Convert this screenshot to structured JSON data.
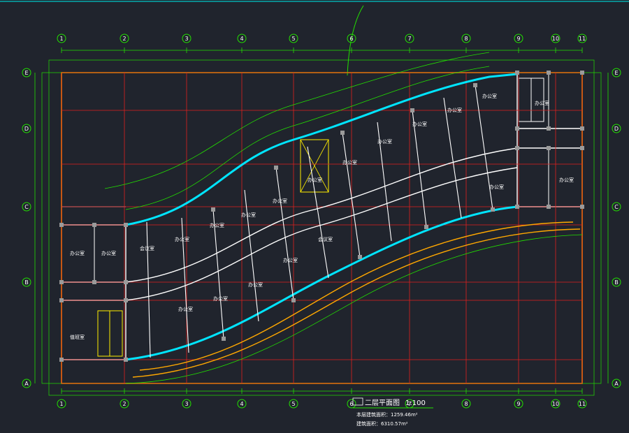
{
  "colors": {
    "background": "#20242d",
    "grid_axis": "#e0201e",
    "dimension": "#22e000",
    "wall": "#ffffff",
    "outline": "#ffa800",
    "glass": "#00e5ff",
    "furniture": "#e000e0",
    "text": "#ffffff",
    "stair_yellow": "#ffee00",
    "top_line": "#00c8c8"
  },
  "grid_top_labels": [
    "1",
    "2",
    "3",
    "4",
    "5",
    "6",
    "7",
    "8",
    "9",
    "10",
    "11"
  ],
  "grid_bottom_labels": [
    "1",
    "2",
    "3",
    "4",
    "5",
    "6",
    "7",
    "8",
    "9",
    "10",
    "11"
  ],
  "grid_left_labels": [
    "E",
    "D",
    "C",
    "B",
    "A"
  ],
  "grid_right_labels": [
    "E",
    "D",
    "C",
    "B",
    "A"
  ],
  "title": {
    "name": "二层平面图",
    "scale": "1:100",
    "area1": "本层建筑面积：1259.46m²",
    "area2": "建筑面积：6310.57m²"
  },
  "room_labels": [
    "办公室",
    "办公室",
    "会议室",
    "办公室",
    "办公室",
    "办公室",
    "办公室",
    "办公室",
    "办公室",
    "办公室",
    "办公室",
    "办公室",
    "办公室",
    "办公室",
    "办公室",
    "办公室",
    "办公室",
    "会议室",
    "值班室",
    "办公室",
    "办公室",
    "办公室"
  ]
}
